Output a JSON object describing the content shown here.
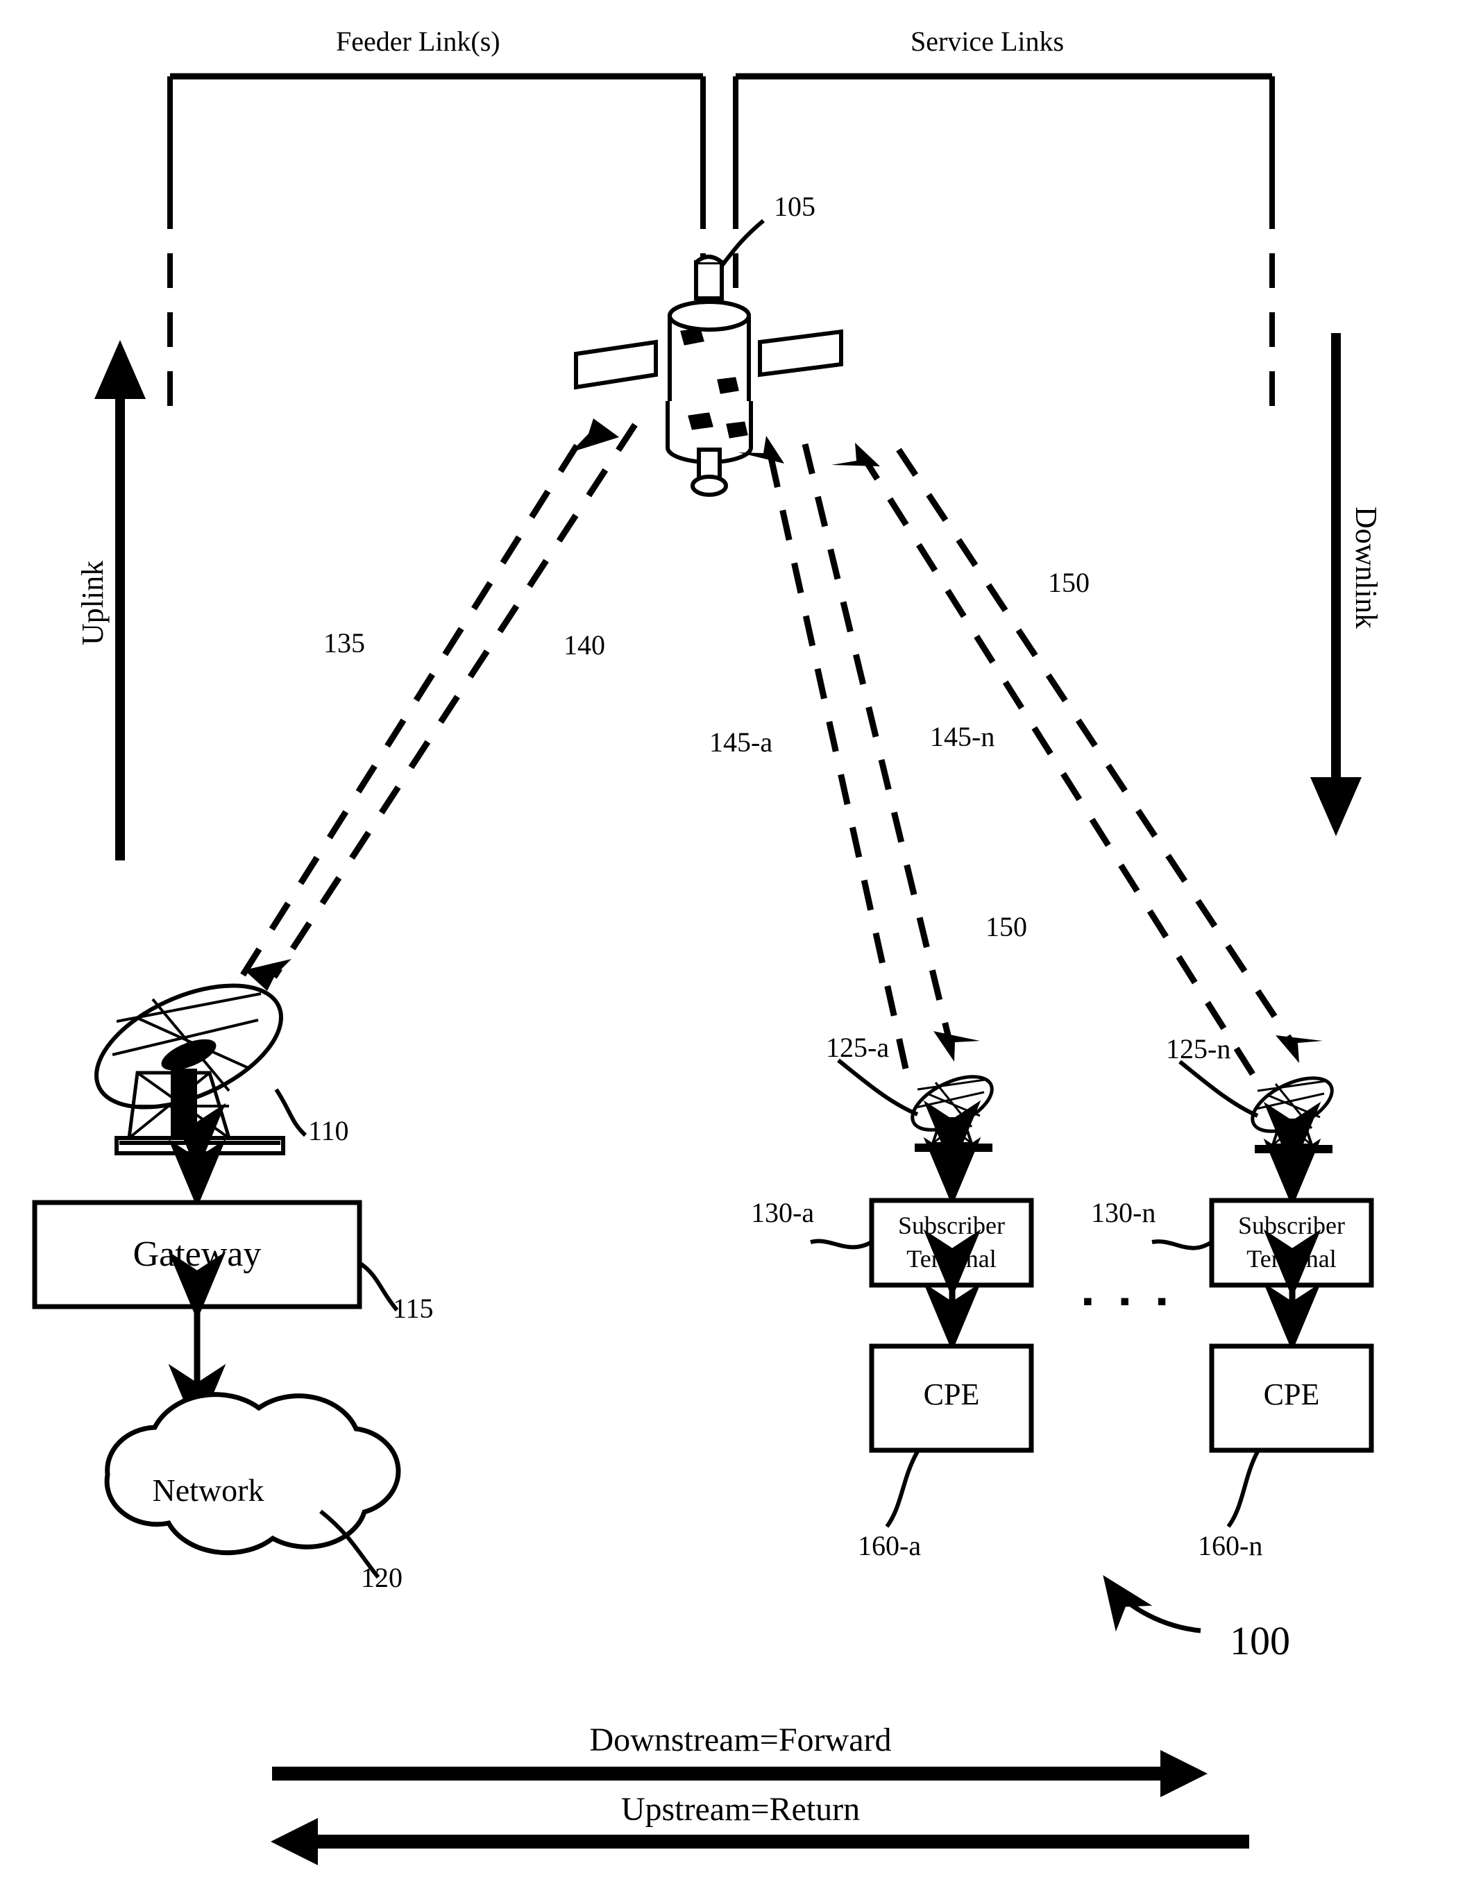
{
  "figure": {
    "number": "100",
    "type": "satellite-communications-system-block-diagram"
  },
  "top_brackets": [
    {
      "label": "Feeder Link(s)",
      "name": "feeder-links"
    },
    {
      "label": "Service Links",
      "name": "service-links"
    }
  ],
  "direction_arrows": {
    "uplink": "Uplink",
    "downlink": "Downlink"
  },
  "nodes": {
    "satellite": {
      "ref": "105"
    },
    "gateway_antenna": {
      "ref": "110"
    },
    "gateway": {
      "label": "Gateway",
      "ref": "115"
    },
    "network": {
      "label": "Network",
      "ref": "120"
    },
    "user_antenna_a": {
      "ref": "125-a"
    },
    "user_antenna_n": {
      "ref": "125-n"
    },
    "subscriber_terminal_a": {
      "label_line1": "Subscriber",
      "label_line2": "Terminal",
      "ref": "130-a"
    },
    "subscriber_terminal_n": {
      "label_line1": "Subscriber",
      "label_line2": "Terminal",
      "ref": "130-n"
    },
    "cpe_a": {
      "label": "CPE",
      "ref": "160-a"
    },
    "cpe_n": {
      "label": "CPE",
      "ref": "160-n"
    }
  },
  "beams": {
    "feeder_uplink": "135",
    "feeder_downlink": "140",
    "service_beam_a": "145-a",
    "service_beam_n": "145-n",
    "spot_beam_upper": "150",
    "spot_beam_lower": "150"
  },
  "ellipsis": "▪ ▪ ▪",
  "flow_arrows": {
    "downstream": "Downstream=Forward",
    "upstream": "Upstream=Return"
  },
  "colors": {
    "ink": "#000000",
    "paper": "#ffffff"
  }
}
